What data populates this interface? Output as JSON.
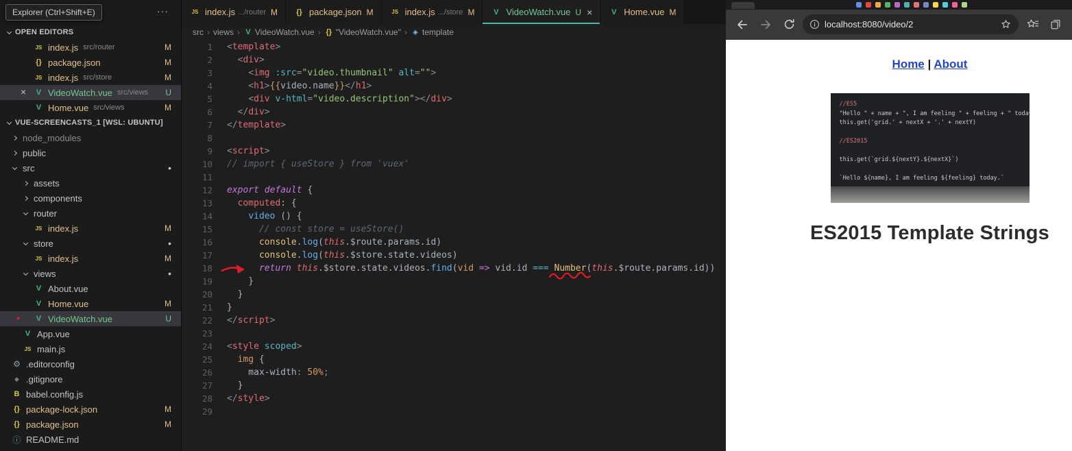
{
  "colors": {
    "vue_green": "#41b883",
    "git_modified": "#e2c08d",
    "git_untracked": "#73c991",
    "active_tab_underline": "#45b8ab",
    "annotation_red": "#e01b24",
    "link_blue": "#2244cc"
  },
  "icons": {
    "js": "JS",
    "json": "{}",
    "vue": "V",
    "gear": "⚙",
    "diamond": "◆",
    "babel": "B",
    "info": "ⓘ",
    "symbol": "◈",
    "close": "×",
    "dot": "●",
    "mod_dot": "•",
    "more": "···",
    "crumb_separator": "›"
  },
  "vscode": {
    "explorer_tooltip": "Explorer (Ctrl+Shift+E)",
    "open_editors": {
      "header": "OPEN EDITORS",
      "items": [
        {
          "icon": "js",
          "label": "index.js",
          "desc": "src/router",
          "badge": "M",
          "status": "mod"
        },
        {
          "icon": "json",
          "label": "package.json",
          "badge": "M",
          "status": "mod"
        },
        {
          "icon": "js",
          "label": "index.js",
          "desc": "src/store",
          "badge": "M",
          "status": "mod"
        },
        {
          "icon": "vue",
          "label": "VideoWatch.vue",
          "desc": "src/views",
          "badge": "U",
          "status": "unt",
          "active": true
        },
        {
          "icon": "vue",
          "label": "Home.vue",
          "desc": "src/views",
          "badge": "M",
          "status": "mod"
        }
      ]
    },
    "workspace": {
      "header": "VUE-SCREENCASTS_1 [WSL: UBUNTU]",
      "items": [
        {
          "kind": "folder",
          "state": "collapsed",
          "label": "node_modules",
          "indent": 0,
          "dim": true
        },
        {
          "kind": "folder",
          "state": "collapsed",
          "label": "public",
          "indent": 0
        },
        {
          "kind": "folder",
          "state": "expanded",
          "label": "src",
          "indent": 0,
          "dot": true
        },
        {
          "kind": "folder",
          "state": "collapsed",
          "label": "assets",
          "indent": 1
        },
        {
          "kind": "folder",
          "state": "collapsed",
          "label": "components",
          "indent": 1
        },
        {
          "kind": "folder",
          "state": "expanded",
          "label": "router",
          "indent": 1
        },
        {
          "kind": "file",
          "icon": "js",
          "label": "index.js",
          "indent": 2,
          "badge": "M",
          "status": "mod"
        },
        {
          "kind": "folder",
          "state": "expanded",
          "label": "store",
          "indent": 1,
          "dot": true
        },
        {
          "kind": "file",
          "icon": "js",
          "label": "index.js",
          "indent": 2,
          "badge": "M",
          "status": "mod"
        },
        {
          "kind": "folder",
          "state": "expanded",
          "label": "views",
          "indent": 1,
          "dot": true
        },
        {
          "kind": "file",
          "icon": "vue",
          "label": "About.vue",
          "indent": 2
        },
        {
          "kind": "file",
          "icon": "vue",
          "label": "Home.vue",
          "indent": 2,
          "badge": "M",
          "status": "mod"
        },
        {
          "kind": "file",
          "icon": "vue",
          "label": "VideoWatch.vue",
          "indent": 2,
          "badge": "U",
          "status": "unt",
          "selected": true,
          "reddot": true
        },
        {
          "kind": "file",
          "icon": "vue",
          "label": "App.vue",
          "indent": 1
        },
        {
          "kind": "file",
          "icon": "js",
          "label": "main.js",
          "indent": 1
        },
        {
          "kind": "file",
          "icon": "gear",
          "label": ".editorconfig",
          "indent": 0
        },
        {
          "kind": "file",
          "icon": "diamond",
          "label": ".gitignore",
          "indent": 0
        },
        {
          "kind": "file",
          "icon": "babel",
          "label": "babel.config.js",
          "indent": 0
        },
        {
          "kind": "file",
          "icon": "json",
          "label": "package-lock.json",
          "indent": 0,
          "badge": "M",
          "status": "mod"
        },
        {
          "kind": "file",
          "icon": "json",
          "label": "package.json",
          "indent": 0,
          "badge": "M",
          "status": "mod"
        },
        {
          "kind": "file",
          "icon": "info",
          "label": "README.md",
          "indent": 0
        }
      ]
    },
    "tabs": [
      {
        "icon": "js",
        "label": "index.js",
        "dim": ".../router",
        "badge": "M",
        "status": "mod"
      },
      {
        "icon": "json",
        "label": "package.json",
        "badge": "M",
        "status": "mod"
      },
      {
        "icon": "js",
        "label": "index.js",
        "dim": ".../store",
        "badge": "M",
        "status": "mod"
      },
      {
        "icon": "vue",
        "label": "VideoWatch.vue",
        "badge": "U",
        "status": "unt",
        "active": true,
        "close": true
      },
      {
        "icon": "vue",
        "label": "Home.vue",
        "badge": "M",
        "status": "mod"
      }
    ],
    "breadcrumb": [
      {
        "label": "src"
      },
      {
        "label": "views"
      },
      {
        "icon": "vue",
        "label": "VideoWatch.vue"
      },
      {
        "icon": "json",
        "label": "\"VideoWatch.vue\""
      },
      {
        "icon": "symbol",
        "label": "template"
      }
    ],
    "code": {
      "lines": [
        [
          [
            "p",
            "<"
          ],
          [
            "t",
            "template"
          ],
          [
            "p",
            ">"
          ]
        ],
        [
          [
            "w",
            "  "
          ],
          [
            "p",
            "<"
          ],
          [
            "t",
            "div"
          ],
          [
            "p",
            ">"
          ]
        ],
        [
          [
            "w",
            "    "
          ],
          [
            "p",
            "<"
          ],
          [
            "t",
            "img"
          ],
          [
            "w",
            " "
          ],
          [
            "a",
            ":src"
          ],
          [
            "p",
            "="
          ],
          [
            "s",
            "\"video.thumbnail\""
          ],
          [
            "w",
            " "
          ],
          [
            "a",
            "alt"
          ],
          [
            "p",
            "="
          ],
          [
            "s",
            "\"\""
          ],
          [
            "p",
            ">"
          ]
        ],
        [
          [
            "w",
            "    "
          ],
          [
            "p",
            "<"
          ],
          [
            "t",
            "h1"
          ],
          [
            "p",
            ">"
          ],
          [
            "n",
            "{{"
          ],
          [
            "w",
            "video.name"
          ],
          [
            "n",
            "}}"
          ],
          [
            "p",
            "</"
          ],
          [
            "t",
            "h1"
          ],
          [
            "p",
            ">"
          ]
        ],
        [
          [
            "w",
            "    "
          ],
          [
            "p",
            "<"
          ],
          [
            "t",
            "div"
          ],
          [
            "w",
            " "
          ],
          [
            "a",
            "v-html"
          ],
          [
            "p",
            "="
          ],
          [
            "s",
            "\"video.description\""
          ],
          [
            "p",
            "></"
          ],
          [
            "t",
            "div"
          ],
          [
            "p",
            ">"
          ]
        ],
        [
          [
            "w",
            "  "
          ],
          [
            "p",
            "</"
          ],
          [
            "t",
            "div"
          ],
          [
            "p",
            ">"
          ]
        ],
        [
          [
            "p",
            "</"
          ],
          [
            "t",
            "template"
          ],
          [
            "p",
            ">"
          ]
        ],
        [],
        [
          [
            "p",
            "<"
          ],
          [
            "t",
            "script"
          ],
          [
            "p",
            ">"
          ]
        ],
        [
          [
            "c",
            "// import { useStore } from 'vuex'"
          ]
        ],
        [],
        [
          [
            "k",
            "export default"
          ],
          [
            "w",
            " {"
          ]
        ],
        [
          [
            "w",
            "  "
          ],
          [
            "t",
            "computed"
          ],
          [
            "w",
            ": {"
          ]
        ],
        [
          [
            "w",
            "    "
          ],
          [
            "fn",
            "video"
          ],
          [
            "w",
            " () {"
          ]
        ],
        [
          [
            "w",
            "      "
          ],
          [
            "c",
            "// const store = useStore()"
          ]
        ],
        [
          [
            "w",
            "      "
          ],
          [
            "cls",
            "console"
          ],
          [
            "w",
            "."
          ],
          [
            "fn",
            "log"
          ],
          [
            "w",
            "("
          ],
          [
            "th",
            "this"
          ],
          [
            "w",
            ".$route.params.id)"
          ]
        ],
        [
          [
            "w",
            "      "
          ],
          [
            "cls",
            "console"
          ],
          [
            "w",
            "."
          ],
          [
            "fn",
            "log"
          ],
          [
            "w",
            "("
          ],
          [
            "th",
            "this"
          ],
          [
            "w",
            ".$store.state.videos)"
          ]
        ],
        [
          [
            "w",
            "      "
          ],
          [
            "k",
            "return"
          ],
          [
            "w",
            " "
          ],
          [
            "th",
            "this"
          ],
          [
            "w",
            ".$store.state.videos."
          ],
          [
            "fn",
            "find"
          ],
          [
            "w",
            "("
          ],
          [
            "n",
            "vid"
          ],
          [
            "w",
            " "
          ],
          [
            "k",
            "=>"
          ],
          [
            "w",
            " vid.id "
          ],
          [
            "op",
            "==="
          ],
          [
            "w",
            " "
          ],
          [
            "ne",
            "Number"
          ],
          [
            "w",
            "("
          ],
          [
            "th",
            "this"
          ],
          [
            "w",
            ".$route.params.id))"
          ]
        ],
        [
          [
            "w",
            "    }"
          ]
        ],
        [
          [
            "w",
            "  }"
          ]
        ],
        [
          [
            "w",
            "}"
          ]
        ],
        [
          [
            "p",
            "</"
          ],
          [
            "t",
            "script"
          ],
          [
            "p",
            ">"
          ]
        ],
        [],
        [
          [
            "p",
            "<"
          ],
          [
            "t",
            "style"
          ],
          [
            "w",
            " "
          ],
          [
            "a",
            "scoped"
          ],
          [
            "p",
            ">"
          ]
        ],
        [
          [
            "w",
            "  "
          ],
          [
            "n",
            "img"
          ],
          [
            "w",
            " {"
          ]
        ],
        [
          [
            "w",
            "    max-width"
          ],
          [
            "p",
            ":"
          ],
          [
            "w",
            " "
          ],
          [
            "n",
            "50%"
          ],
          [
            "p",
            ";"
          ]
        ],
        [
          [
            "w",
            "  }"
          ]
        ],
        [
          [
            "p",
            "</"
          ],
          [
            "t",
            "style"
          ],
          [
            "p",
            ">"
          ]
        ],
        []
      ]
    }
  },
  "browser": {
    "pinned_favicon_colors": [
      "#5f8fe8",
      "#e8453c",
      "#f2a93b",
      "#58b368",
      "#b968c7",
      "#4db6ac",
      "#e57373",
      "#7986cb",
      "#ffd54f",
      "#4dd0e1",
      "#f06292",
      "#aed581"
    ],
    "toolbar": {
      "url": "localhost:8080/video/2"
    },
    "page": {
      "link_home": "Home",
      "separator": "|",
      "link_about": "About",
      "heading": "ES2015 Template Strings",
      "screenshot_code": [
        {
          "cls": "cm",
          "text": "//ES5"
        },
        {
          "cls": "tx",
          "text": "\"Hello \" + name + \", I am feeling \" + feeling + \" today.\""
        },
        {
          "cls": "tx",
          "text": "this.get('grid.' + nextX + '.' + nextY)"
        },
        {
          "cls": "tx",
          "text": ""
        },
        {
          "cls": "cm",
          "text": "//ES2015"
        },
        {
          "cls": "tx",
          "text": ""
        },
        {
          "cls": "tx",
          "text": "this.get(`grid.${nextY}.${nextX}`)"
        },
        {
          "cls": "tx",
          "text": ""
        },
        {
          "cls": "tx",
          "text": "`Hello ${name}, I am feeling ${feeling} today.`"
        }
      ]
    }
  }
}
